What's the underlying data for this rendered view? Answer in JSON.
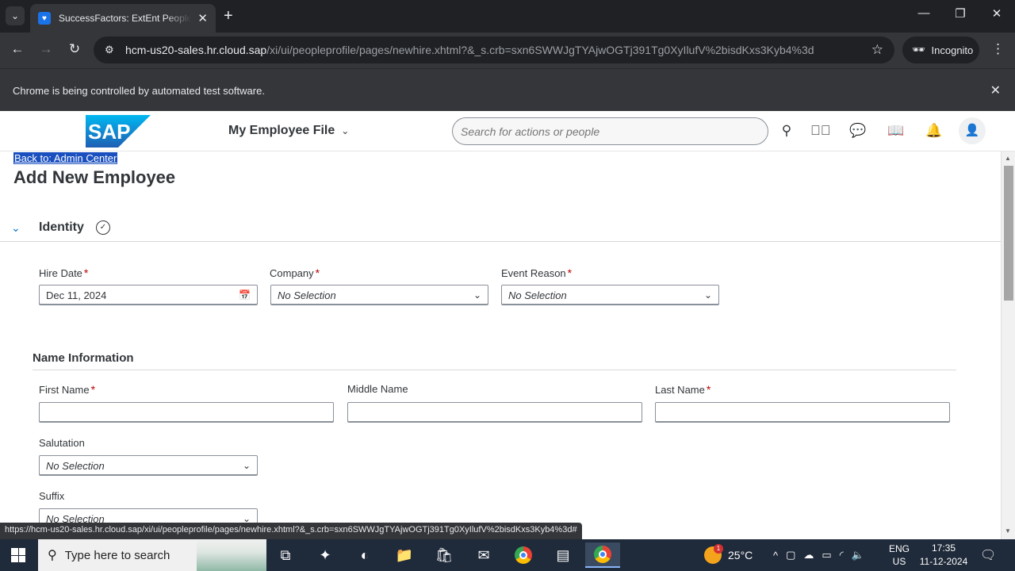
{
  "browser": {
    "tab_title": "SuccessFactors: ExtEnt PeopleProfile",
    "tab_close": "✕",
    "new_tab": "+",
    "url_host": "hcm-us20-sales.hr.cloud.sap",
    "url_path": "/xi/ui/peopleprofile/pages/newhire.xhtml?&_s.crb=sxn6SWWJgTYAjwOGTj391Tg0XyIlufV%2bisdKxs3Kyb4%3d",
    "incognito_label": "Incognito",
    "automation_notice": "Chrome is being controlled by automated test software.",
    "status_url": "https://hcm-us20-sales.hr.cloud.sap/xi/ui/peopleprofile/pages/newhire.xhtml?&_s.crb=sxn6SWWJgTYAjwOGTj391Tg0XyIlufV%2bisdKxs3Kyb4%3d#"
  },
  "shell": {
    "logo_text": "SAP",
    "module_label": "My Employee File",
    "search_placeholder": "Search for actions or people"
  },
  "page": {
    "back_link": "Back to: Admin Center",
    "title": "Add New Employee"
  },
  "identity": {
    "title": "Identity",
    "hire_date": {
      "label": "Hire Date",
      "value": "Dec 11, 2024"
    },
    "company": {
      "label": "Company",
      "value": "No Selection"
    },
    "event_reason": {
      "label": "Event Reason",
      "value": "No Selection"
    }
  },
  "name_info": {
    "title": "Name Information",
    "first_name": {
      "label": "First Name",
      "value": ""
    },
    "middle_name": {
      "label": "Middle Name",
      "value": ""
    },
    "last_name": {
      "label": "Last Name",
      "value": ""
    },
    "salutation": {
      "label": "Salutation",
      "value": "No Selection"
    },
    "suffix": {
      "label": "Suffix",
      "value": "No Selection"
    }
  },
  "required_marker": "*",
  "taskbar": {
    "search_text": "Type here to search",
    "temperature": "25°C",
    "weather_badge": "1",
    "lang_top": "ENG",
    "lang_bottom": "US",
    "time": "17:35",
    "date": "11-12-2024"
  }
}
